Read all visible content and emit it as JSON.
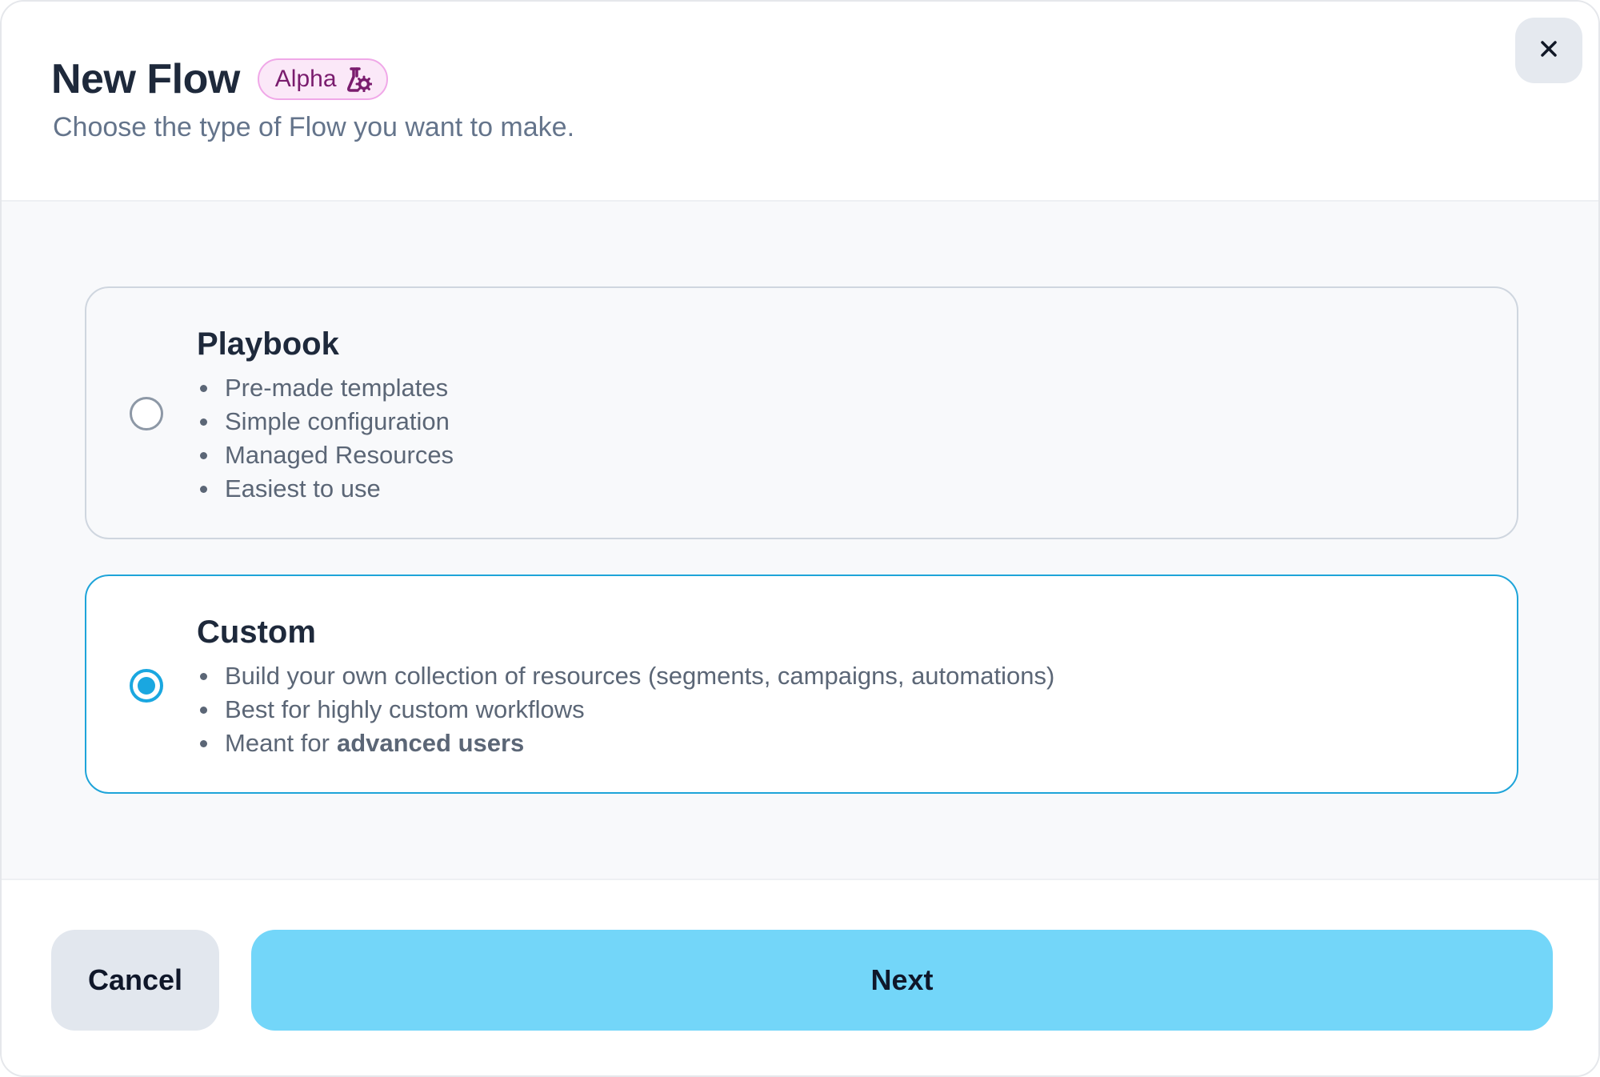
{
  "header": {
    "title": "New Flow",
    "badge": "Alpha",
    "badge_icon": "flask-gear-icon",
    "subtitle": "Choose the type of Flow you want to make.",
    "close_icon": "close-icon"
  },
  "options": [
    {
      "title": "Playbook",
      "selected": false,
      "bullets": [
        "Pre-made templates",
        "Simple configuration",
        "Managed Resources",
        "Easiest to use"
      ]
    },
    {
      "title": "Custom",
      "selected": true,
      "bullets": [
        "Build your own collection of resources (segments, campaigns, automations)",
        "Best for highly custom workflows"
      ],
      "last_bullet_prefix": "Meant for",
      "last_bullet_strong": "advanced users"
    }
  ],
  "footer": {
    "cancel_label": "Cancel",
    "next_label": "Next"
  },
  "colors": {
    "accent": "#1aa7e0",
    "next_button": "#73d6f9",
    "badge_bg": "#fbe8f8",
    "badge_text": "#7a1c6e"
  }
}
